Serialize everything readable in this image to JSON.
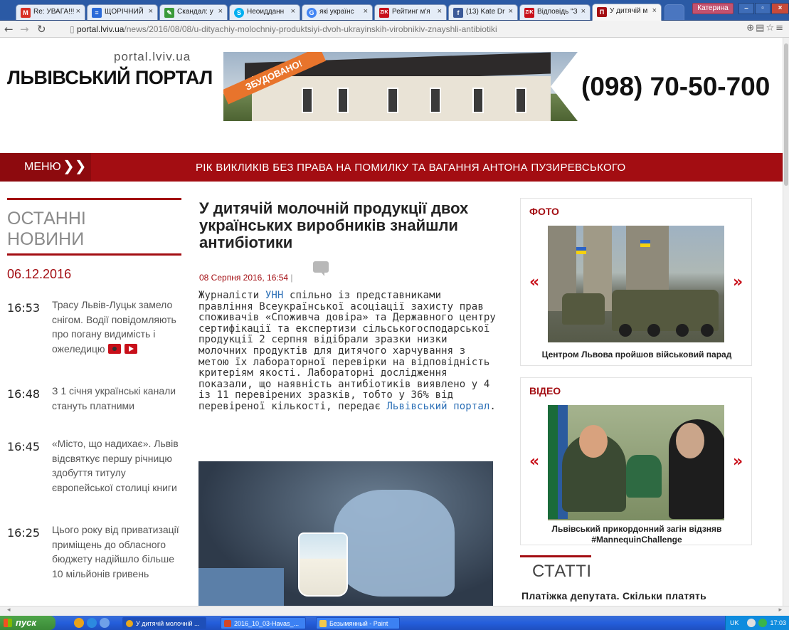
{
  "browser": {
    "tabs": [
      {
        "label": "Re: УВАГА!!!",
        "favicon": "gmail-icon",
        "color": "#d93025"
      },
      {
        "label": "ЩОРІЧНИЙ",
        "favicon": "docs-icon",
        "color": "#2a6ad8"
      },
      {
        "label": "Скандал: у",
        "favicon": "pencil-icon",
        "color": "#3a9a3a"
      },
      {
        "label": "Неоидданн",
        "favicon": "skype-icon",
        "color": "#00aff0"
      },
      {
        "label": "які українс",
        "favicon": "google-icon",
        "color": "#4285f4"
      },
      {
        "label": "Рейтинг м'я",
        "favicon": "zik-icon",
        "color": "#c8101a"
      },
      {
        "label": "(13) Kate Dr",
        "favicon": "facebook-icon",
        "color": "#3b5998"
      },
      {
        "label": "Відповідь \"З",
        "favicon": "zik-icon",
        "color": "#c8101a"
      },
      {
        "label": "У дитячій м",
        "favicon": "portal-icon",
        "color": "#a30d12"
      }
    ],
    "user": "Катерина",
    "url_domain": "portal.lviv.ua",
    "url_path": "/news/2016/08/08/u-dityachiy-molochniy-produktsiyi-dvoh-ukrayinskih-virobnikiv-znayshli-antibiotiki"
  },
  "site": {
    "logo_url": "portal.lviv.ua",
    "logo_name": "ЛЬВІВСЬКИЙ ПОРТАЛ",
    "ad": {
      "ribbon": "ЗБУДОВАНО!",
      "phone": "(098) 70-50-700"
    },
    "menu_label": "МЕНЮ",
    "marquee": "РІК ВИКЛИКІВ БЕЗ ПРАВА НА ПОМИЛКУ ТА ВАГАННЯ АНТОНА ПУЗИРЕВСЬКОГО"
  },
  "latest_news": {
    "title": "ОСТАННІ НОВИНИ",
    "date": "06.12.2016",
    "items": [
      {
        "time": "16:53",
        "text": "Трасу Львів-Луцьк замело снігом. Водії повідомляють про погану видимість і ожеледицю"
      },
      {
        "time": "16:48",
        "text": "З 1 січня українські канали стануть платними"
      },
      {
        "time": "16:45",
        "text": "«Місто, що надихає». Львів відсвяткує першу річницю здобуття титулу європейської столиці книги"
      },
      {
        "time": "16:25",
        "text": "Цього року від приватизації приміщень до обласного бюджету надійшло більше 10 мільйонів гривень"
      }
    ]
  },
  "article": {
    "title": "У дитячій молочній продукції двох українських виробників знайшли антибіотики",
    "date": "08 Серпня 2016, 16:54",
    "separator": "|",
    "body_1": "Журналісти ",
    "link_1": "УНН",
    "body_2": " спільно із представниками правління Всеукраїнської асоціації захисту прав споживачів «Споживча довіра» та Державного центру сертифікації та експертизи сільськогосподарської продукції 2 серпня відібрали зразки низки молочних продуктів для дитячого харчування з метою їх лабораторної перевірки на відповідність критеріям якості. Лабораторні дослідження показали, що наявність антибіотиків виявлено у 4 із 11 перевірених зразків, тобто у 36% від перевіреної кількості, передає ",
    "link_2": "Львівський портал",
    "body_3": "."
  },
  "sidebar": {
    "photo": {
      "title": "ФОТО",
      "caption": "Центром Львова пройшов військовий парад",
      "prev": "«",
      "next": "»"
    },
    "video": {
      "title": "ВІДЕО",
      "caption": "Львівський прикордонний загін відзняв #MannequinChallenge",
      "prev": "«",
      "next": "»"
    },
    "articles": {
      "title": "СТАТТІ",
      "first": "Платіжка депутата. Скільки платять"
    }
  },
  "taskbar": {
    "start": "пуск",
    "tasks": [
      {
        "label": "У дитячій молочній ...",
        "color": "#e9a81b"
      },
      {
        "label": "2016_10_03-Havas_...",
        "color": "#d24726"
      },
      {
        "label": "Безымянный - Paint",
        "color": "#f2c94c"
      }
    ],
    "lang": "UK",
    "clock": "17:03"
  }
}
